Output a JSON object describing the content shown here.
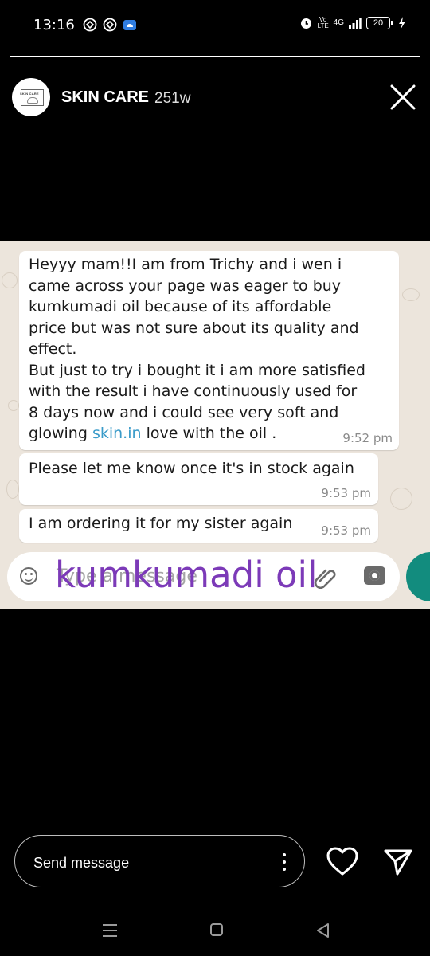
{
  "status_bar": {
    "time": "13:16",
    "network": "4G",
    "volte": "Vo LTE",
    "battery": "20"
  },
  "story": {
    "progress": 1.0,
    "account_name": "SKIN CARE",
    "age": "251w",
    "avatar_logo_text": "SKIN CARE"
  },
  "chat": {
    "messages": [
      {
        "text_before_link": "Heyyy mam!!I am from Trichy and i wen i\ncame across your page was eager to buy\nkumkumadi oil because of its affordable\nprice but was not sure about its quality and\neffect.\nBut just to try i bought it i am more satisfied\nwith the result i have continuously used for\n8 days now and i could see very soft and\nglowing ",
        "link": "skin.in",
        "text_after_link": " love with the oil .",
        "time": "9:52 pm"
      },
      {
        "text": "Please let me know once it's in stock again",
        "time": "9:53 pm"
      },
      {
        "text": "I am ordering it for my sister again",
        "time": "9:53 pm"
      }
    ],
    "input_placeholder": "Type a message",
    "overlay_caption": "kumkumadi oil"
  },
  "reply": {
    "placeholder": "Send message"
  },
  "colors": {
    "chat_background": "#ece5dc",
    "caption": "#7c3ab8",
    "link": "#3a9bc9",
    "whatsapp_green": "#128c7e"
  }
}
